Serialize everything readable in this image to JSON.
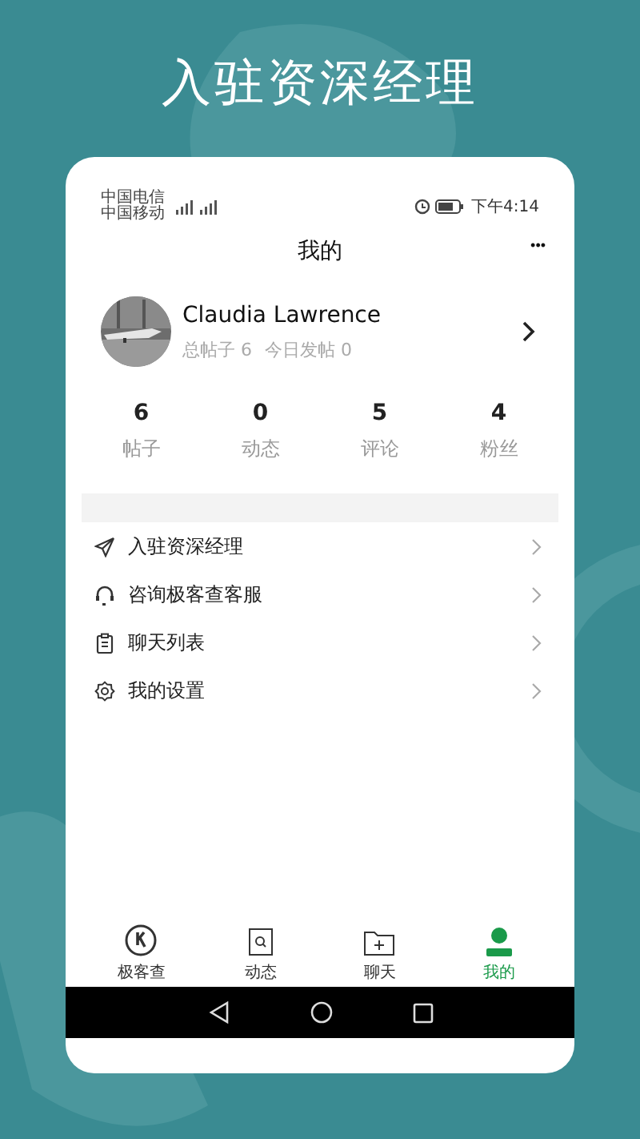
{
  "headline": "入驻资深经理",
  "status_bar": {
    "carriers": [
      "中国电信",
      "中国移动"
    ],
    "time": "下午4:14"
  },
  "header": {
    "title": "我的",
    "more": "•••"
  },
  "profile": {
    "name": "Claudia Lawrence",
    "posts_label": "总帖子 6",
    "today_label": "今日发帖 0"
  },
  "stats": [
    {
      "value": "6",
      "label": "帖子"
    },
    {
      "value": "0",
      "label": "动态"
    },
    {
      "value": "5",
      "label": "评论"
    },
    {
      "value": "4",
      "label": "粉丝"
    }
  ],
  "menu": [
    {
      "label": "入驻资深经理"
    },
    {
      "label": "咨询极客查客服"
    },
    {
      "label": "聊天列表"
    },
    {
      "label": "我的设置"
    }
  ],
  "tabs": [
    {
      "label": "极客查",
      "selected": false
    },
    {
      "label": "动态",
      "selected": false
    },
    {
      "label": "聊天",
      "selected": false
    },
    {
      "label": "我的",
      "selected": true
    }
  ]
}
